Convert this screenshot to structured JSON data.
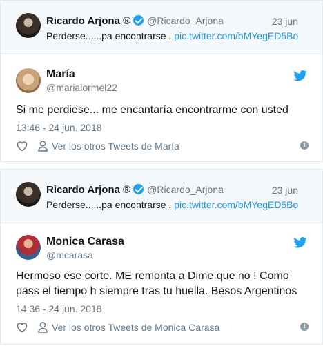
{
  "embeds": [
    {
      "quoted": {
        "name": "Ricardo Arjona ®",
        "handle": "@Ricardo_Arjona",
        "date": "23 jun",
        "text": "Perderse......pa encontrarse . ",
        "link": "pic.twitter.com/bMYegED5Bo"
      },
      "reply": {
        "name": "María",
        "handle": "@marialormel22",
        "text": "Si me perdiese... me encantaría encontrarme con usted",
        "timestamp": "13:46 - 24 jun. 2018",
        "other_tweets_label": "Ver los otros Tweets de María",
        "info_glyph": "i"
      }
    },
    {
      "quoted": {
        "name": "Ricardo Arjona ®",
        "handle": "@Ricardo_Arjona",
        "date": "23 jun",
        "text": "Perderse......pa encontrarse . ",
        "link": "pic.twitter.com/bMYegED5Bo"
      },
      "reply": {
        "name": "Monica Carasa",
        "handle": "@mcarasa",
        "text": "Hermoso ese corte. ME remonta a Dime que no ! Como pass el tiempo h siempre tras tu huella.  Besos Argentinos",
        "timestamp": "14:36 - 24 jun. 2018",
        "other_tweets_label": "Ver los otros Tweets de Monica Carasa",
        "info_glyph": "i"
      }
    }
  ],
  "colors": {
    "twitter_blue": "#1da1f2",
    "link": "#1b95e0",
    "muted": "#657786",
    "border": "#e1e8ed",
    "quoted_bg": "#f5f8fa"
  },
  "icons": [
    "verified-badge-icon",
    "twitter-bird-icon",
    "heart-icon",
    "person-icon",
    "info-icon"
  ]
}
